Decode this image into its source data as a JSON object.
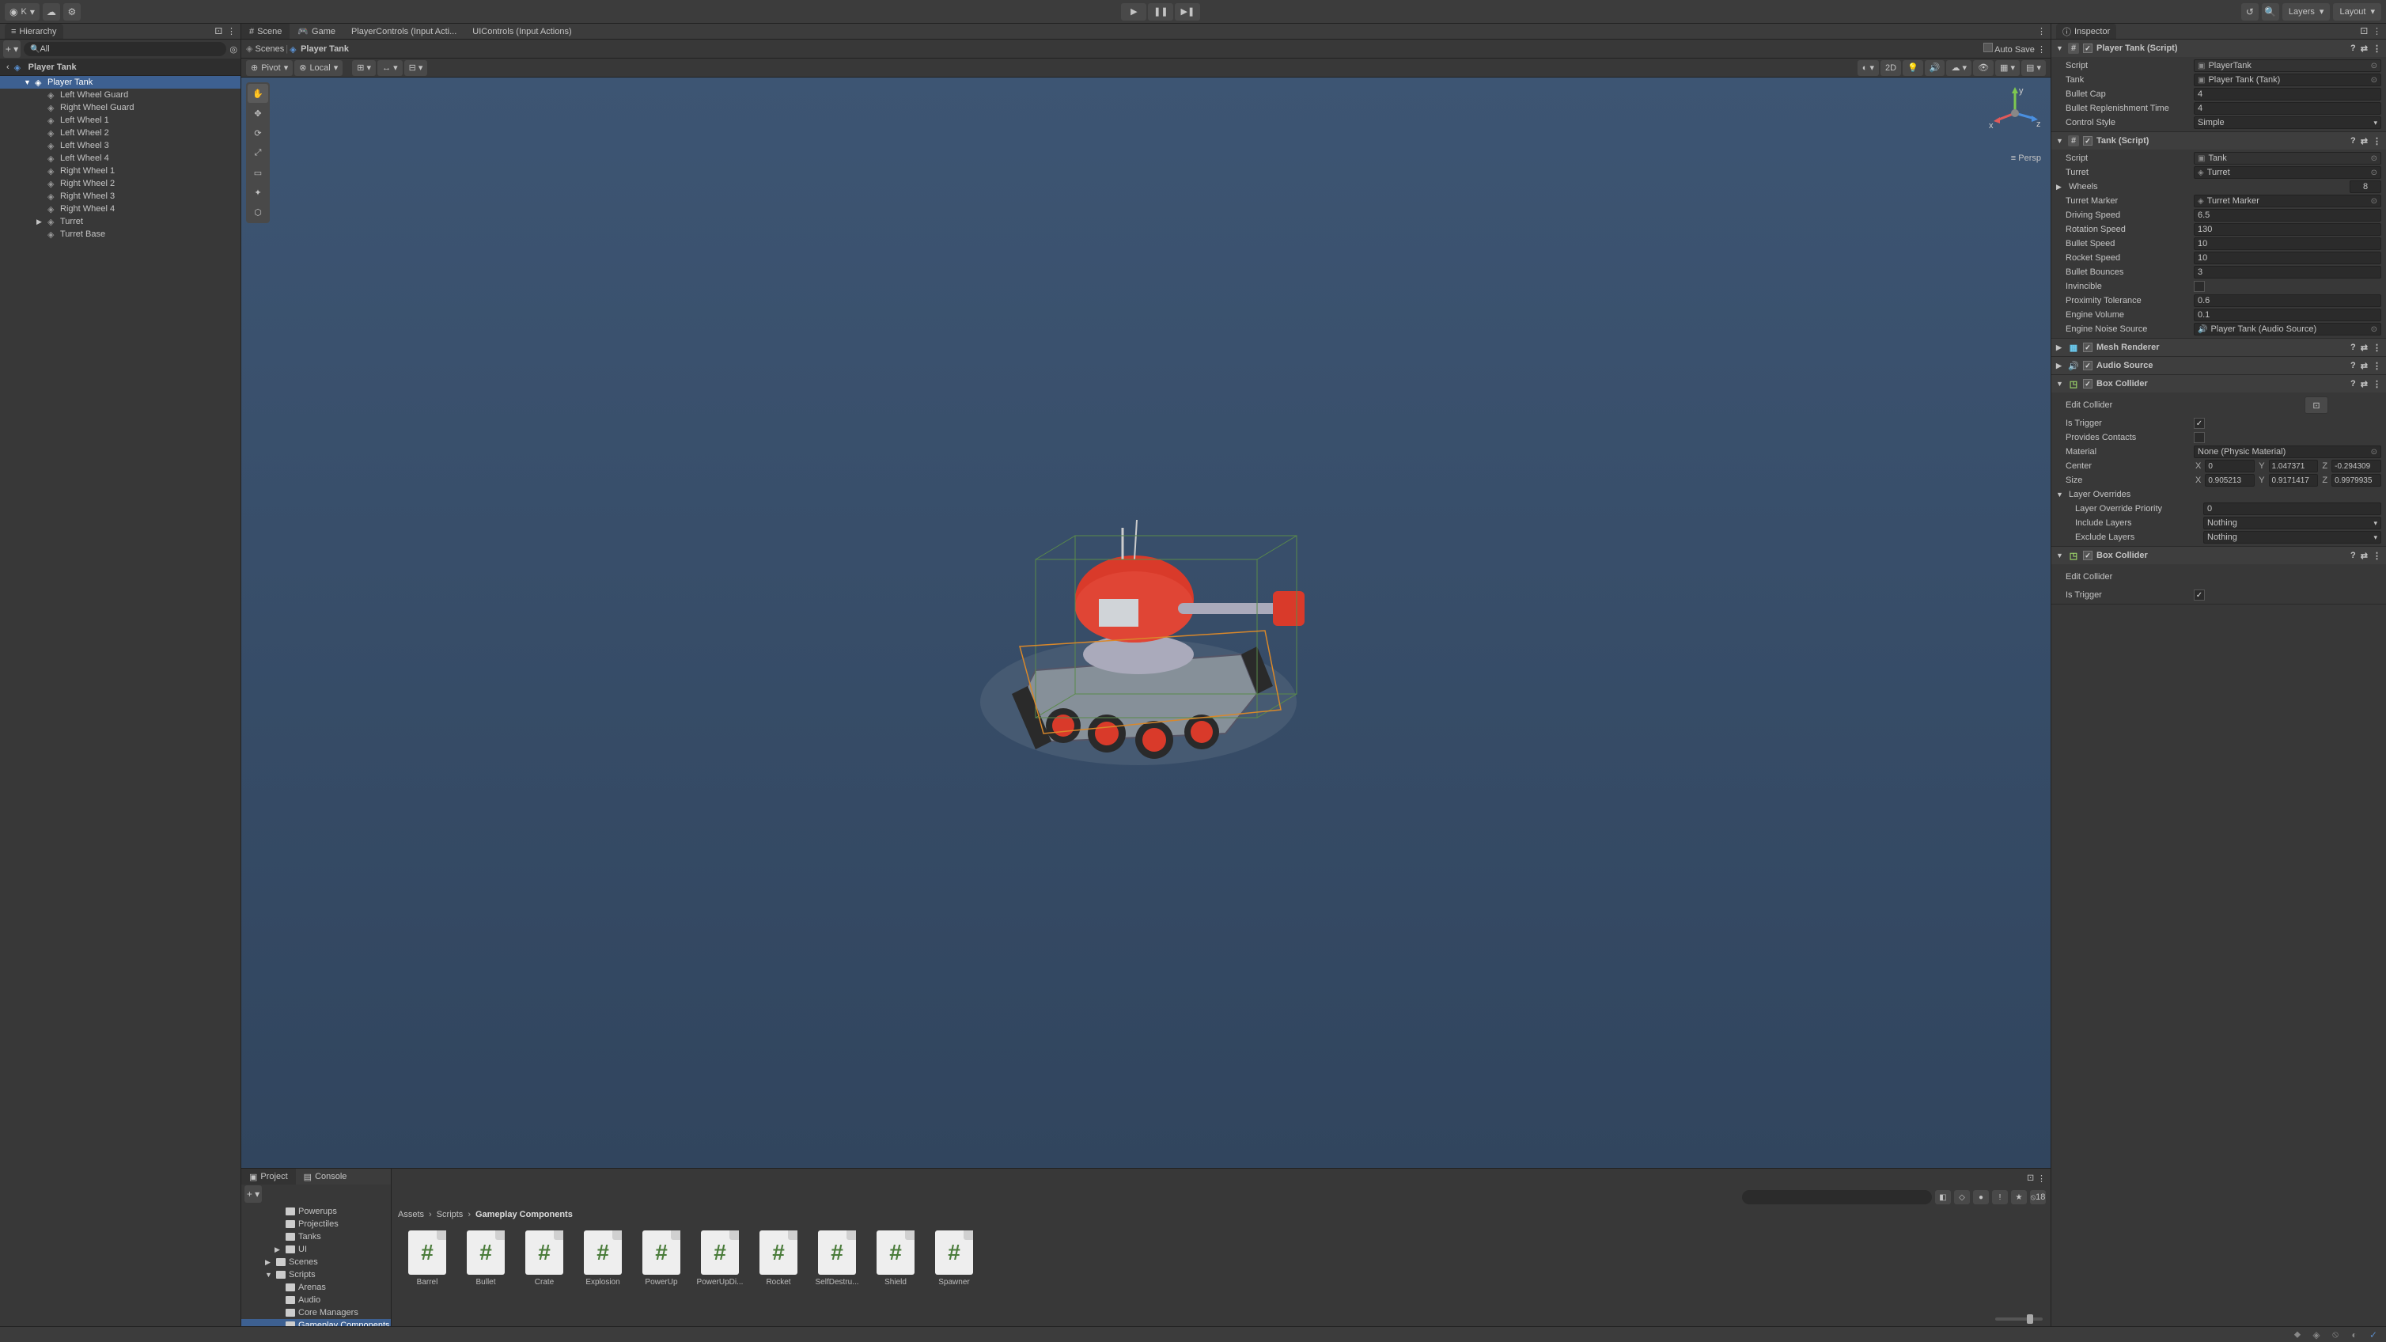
{
  "toolbar": {
    "account": "K",
    "layers": "Layers",
    "layout": "Layout"
  },
  "tabs": {
    "scene": "Scene",
    "game": "Game",
    "pc": "PlayerControls (Input Acti...",
    "uic": "UIControls (Input Actions)"
  },
  "sceneBar": {
    "scenes": "Scenes",
    "prefab": "Player Tank",
    "pivot": "Pivot",
    "local": "Local",
    "twod": "2D",
    "autosave": "Auto Save",
    "persp": "Persp",
    "eye": "18"
  },
  "hierarchy": {
    "title": "Hierarchy",
    "searchPlaceholder": "All",
    "root": "Player Tank",
    "items": [
      {
        "t": "Player Tank",
        "sel": true,
        "d": 0
      },
      {
        "t": "Left Wheel Guard",
        "d": 1
      },
      {
        "t": "Right Wheel Guard",
        "d": 1
      },
      {
        "t": "Left Wheel 1",
        "d": 1
      },
      {
        "t": "Left Wheel 2",
        "d": 1
      },
      {
        "t": "Left Wheel 3",
        "d": 1
      },
      {
        "t": "Left Wheel 4",
        "d": 1
      },
      {
        "t": "Right Wheel 1",
        "d": 1
      },
      {
        "t": "Right Wheel 2",
        "d": 1
      },
      {
        "t": "Right Wheel 3",
        "d": 1
      },
      {
        "t": "Right Wheel 4",
        "d": 1
      },
      {
        "t": "Turret",
        "d": 1,
        "arrow": true
      },
      {
        "t": "Turret Base",
        "d": 1
      }
    ]
  },
  "inspector": {
    "title": "Inspector",
    "playerTank": {
      "title": "Player Tank (Script)",
      "script": "PlayerTank",
      "scriptLbl": "Script",
      "tank": "Player Tank (Tank)",
      "tankLbl": "Tank",
      "bulletCap": "4",
      "bulletCapLbl": "Bullet Cap",
      "brt": "4",
      "brtLbl": "Bullet Replenishment Time",
      "control": "Simple",
      "controlLbl": "Control Style"
    },
    "tank": {
      "title": "Tank (Script)",
      "script": "Tank",
      "scriptLbl": "Script",
      "turret": "Turret",
      "turretLbl": "Turret",
      "wheels": "8",
      "wheelsLbl": "Wheels",
      "tm": "Turret Marker",
      "tmLbl": "Turret Marker",
      "ds": "6.5",
      "dsLbl": "Driving Speed",
      "rs": "130",
      "rsLbl": "Rotation Speed",
      "bs": "10",
      "bsLbl": "Bullet Speed",
      "rks": "10",
      "rksLbl": "Rocket Speed",
      "bb": "3",
      "bbLbl": "Bullet Bounces",
      "invLbl": "Invincible",
      "pt": "0.6",
      "ptLbl": "Proximity Tolerance",
      "ev": "0.1",
      "evLbl": "Engine Volume",
      "ens": "Player Tank (Audio Source)",
      "ensLbl": "Engine Noise Source"
    },
    "mesh": {
      "title": "Mesh Renderer"
    },
    "audio": {
      "title": "Audio Source"
    },
    "box1": {
      "title": "Box Collider",
      "editLbl": "Edit Collider",
      "trigLbl": "Is Trigger",
      "pcLbl": "Provides Contacts",
      "mat": "None (Physic Material)",
      "matLbl": "Material",
      "centerLbl": "Center",
      "cx": "0",
      "cy": "1.047371",
      "cz": "-0.294309",
      "sizeLbl": "Size",
      "sx": "0.905213",
      "sy": "0.9171417",
      "sz": "0.9979935",
      "loLbl": "Layer Overrides",
      "lop": "0",
      "lopLbl": "Layer Override Priority",
      "inc": "Nothing",
      "incLbl": "Include Layers",
      "exc": "Nothing",
      "excLbl": "Exclude Layers"
    },
    "box2": {
      "title": "Box Collider",
      "editLbl": "Edit Collider",
      "trigLbl": "Is Trigger"
    }
  },
  "project": {
    "projectTab": "Project",
    "consoleTab": "Console",
    "tree": [
      {
        "t": "Powerups",
        "d": 2
      },
      {
        "t": "Projectiles",
        "d": 2
      },
      {
        "t": "Tanks",
        "d": 2
      },
      {
        "t": "UI",
        "d": 2,
        "arrow": true
      },
      {
        "t": "Scenes",
        "d": 1,
        "arrow": true
      },
      {
        "t": "Scripts",
        "d": 1,
        "arrow": true,
        "open": true
      },
      {
        "t": "Arenas",
        "d": 2
      },
      {
        "t": "Audio",
        "d": 2
      },
      {
        "t": "Core Managers",
        "d": 2
      },
      {
        "t": "Gameplay Components",
        "d": 2,
        "sel": true
      }
    ],
    "crumbs": [
      "Assets",
      "Scripts",
      "Gameplay Components"
    ],
    "assets": [
      "Barrel",
      "Bullet",
      "Crate",
      "Explosion",
      "PowerUp",
      "PowerUpDi...",
      "Rocket",
      "SelfDestru...",
      "Shield",
      "Spawner"
    ]
  }
}
